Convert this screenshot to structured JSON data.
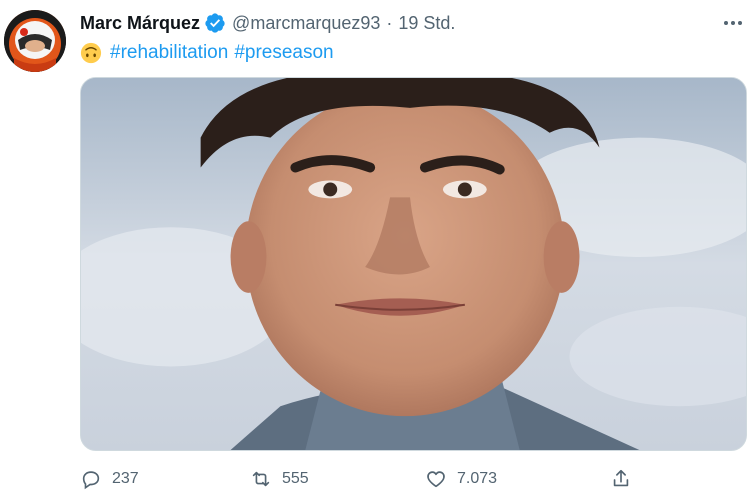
{
  "tweet": {
    "author": {
      "name": "Marc Márquez",
      "handle": "@marcmarquez93",
      "verified": true,
      "avatar_icon": "helmet-avatar"
    },
    "time": "19 Std.",
    "separator": "·",
    "text": {
      "emoji": "upside-down-face-icon",
      "hashtags": [
        "#rehabilitation",
        "#preseason"
      ]
    },
    "media": {
      "type": "photo"
    },
    "actions": {
      "replies": "237",
      "retweets": "555",
      "likes": "7.073"
    },
    "colors": {
      "accent": "#1d9bf0",
      "secondary_text": "#536471",
      "primary_text": "#0f1419"
    }
  }
}
